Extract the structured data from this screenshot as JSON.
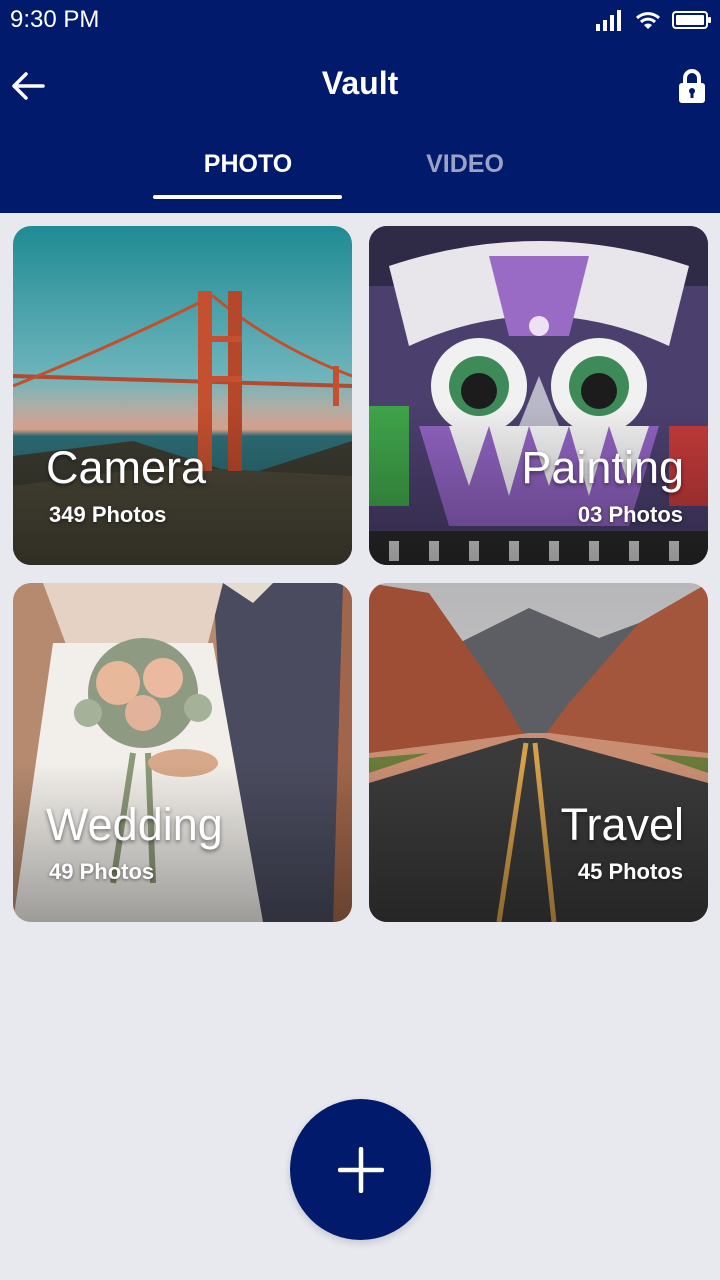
{
  "status_bar": {
    "time": "9:30 PM"
  },
  "toolbar": {
    "title": "Vault"
  },
  "tabs": [
    {
      "label": "PHOTO",
      "selected": true
    },
    {
      "label": "VIDEO",
      "selected": false
    }
  ],
  "albums": [
    {
      "name": "Camera",
      "count": "349 Photos"
    },
    {
      "name": "Painting",
      "count": "03 Photos"
    },
    {
      "name": "Wedding",
      "count": "49 Photos"
    },
    {
      "name": "Travel",
      "count": "45 Photos"
    }
  ],
  "colors": {
    "primary": "#021a6b",
    "background": "#e8e9ef",
    "tab_inactive": "#9aa3c6"
  },
  "icons": {
    "back": "arrow-left-icon",
    "lock": "lock-icon",
    "add": "plus-icon",
    "signal": "signal-icon",
    "wifi": "wifi-icon",
    "battery": "battery-icon"
  }
}
